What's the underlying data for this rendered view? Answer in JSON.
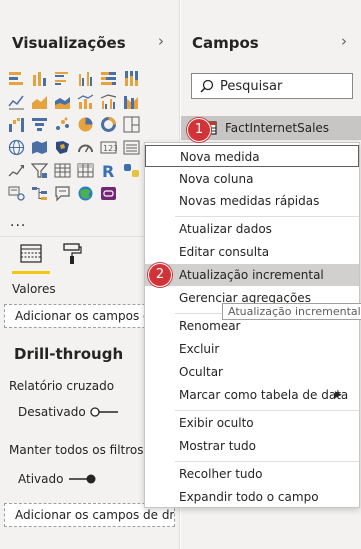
{
  "visualizations": {
    "title": "Visualizações",
    "more_label": "...",
    "wells": {
      "values_label": "Valores",
      "values_placeholder": "Adicionar os campos de"
    },
    "drillthrough": {
      "title": "Drill-through",
      "cross_report_label": "Relatório cruzado",
      "cross_report_state": "Desativado",
      "keep_filters_label": "Manter todos os filtros",
      "keep_filters_state": "Ativado",
      "placeholder": "Adicionar os campos de dr..."
    },
    "icons": [
      [
        "stacked-bar-icon",
        "stacked-column-icon",
        "clustered-bar-icon",
        "clustered-column-icon",
        "100-bar-icon",
        "100-column-icon"
      ],
      [
        "line-chart-icon",
        "area-chart-icon",
        "stacked-area-icon",
        "line-column-icon",
        "line-clustered-icon",
        "ribbon-chart-icon"
      ],
      [
        "waterfall-icon",
        "funnel-icon",
        "scatter-icon",
        "pie-icon",
        "donut-icon",
        "treemap-icon"
      ],
      [
        "map-icon",
        "filled-map-icon",
        "shape-map-icon",
        "gauge-icon",
        "card-icon",
        "multirow-card-icon"
      ],
      [
        "kpi-icon",
        "slicer-icon",
        "table-icon",
        "matrix-icon",
        "r-visual-icon",
        "python-visual-icon"
      ],
      [
        "key-influencers-icon",
        "decomposition-tree-icon",
        "qa-icon",
        "arcgis-icon",
        "power-apps-icon"
      ]
    ]
  },
  "fields": {
    "title": "Campos",
    "search_placeholder": "Pesquisar",
    "table_name": "FactInternetSales"
  },
  "context_menu": {
    "items": [
      "Nova medida",
      "Nova coluna",
      "Novas medidas rápidas",
      "Atualizar dados",
      "Editar consulta",
      "Atualização incremental",
      "Gerenciar agregações",
      "Renomear",
      "Excluir",
      "Ocultar",
      "Marcar como tabela de data",
      "Exibir oculto",
      "Mostrar tudo",
      "Recolher tudo",
      "Expandir todo o campo"
    ]
  },
  "tooltip": "Atualização incremental",
  "badges": [
    "1",
    "2"
  ],
  "colors": {
    "accent": "#f2c811",
    "badge": "#d13438",
    "highlight": "#d2d0ce"
  }
}
